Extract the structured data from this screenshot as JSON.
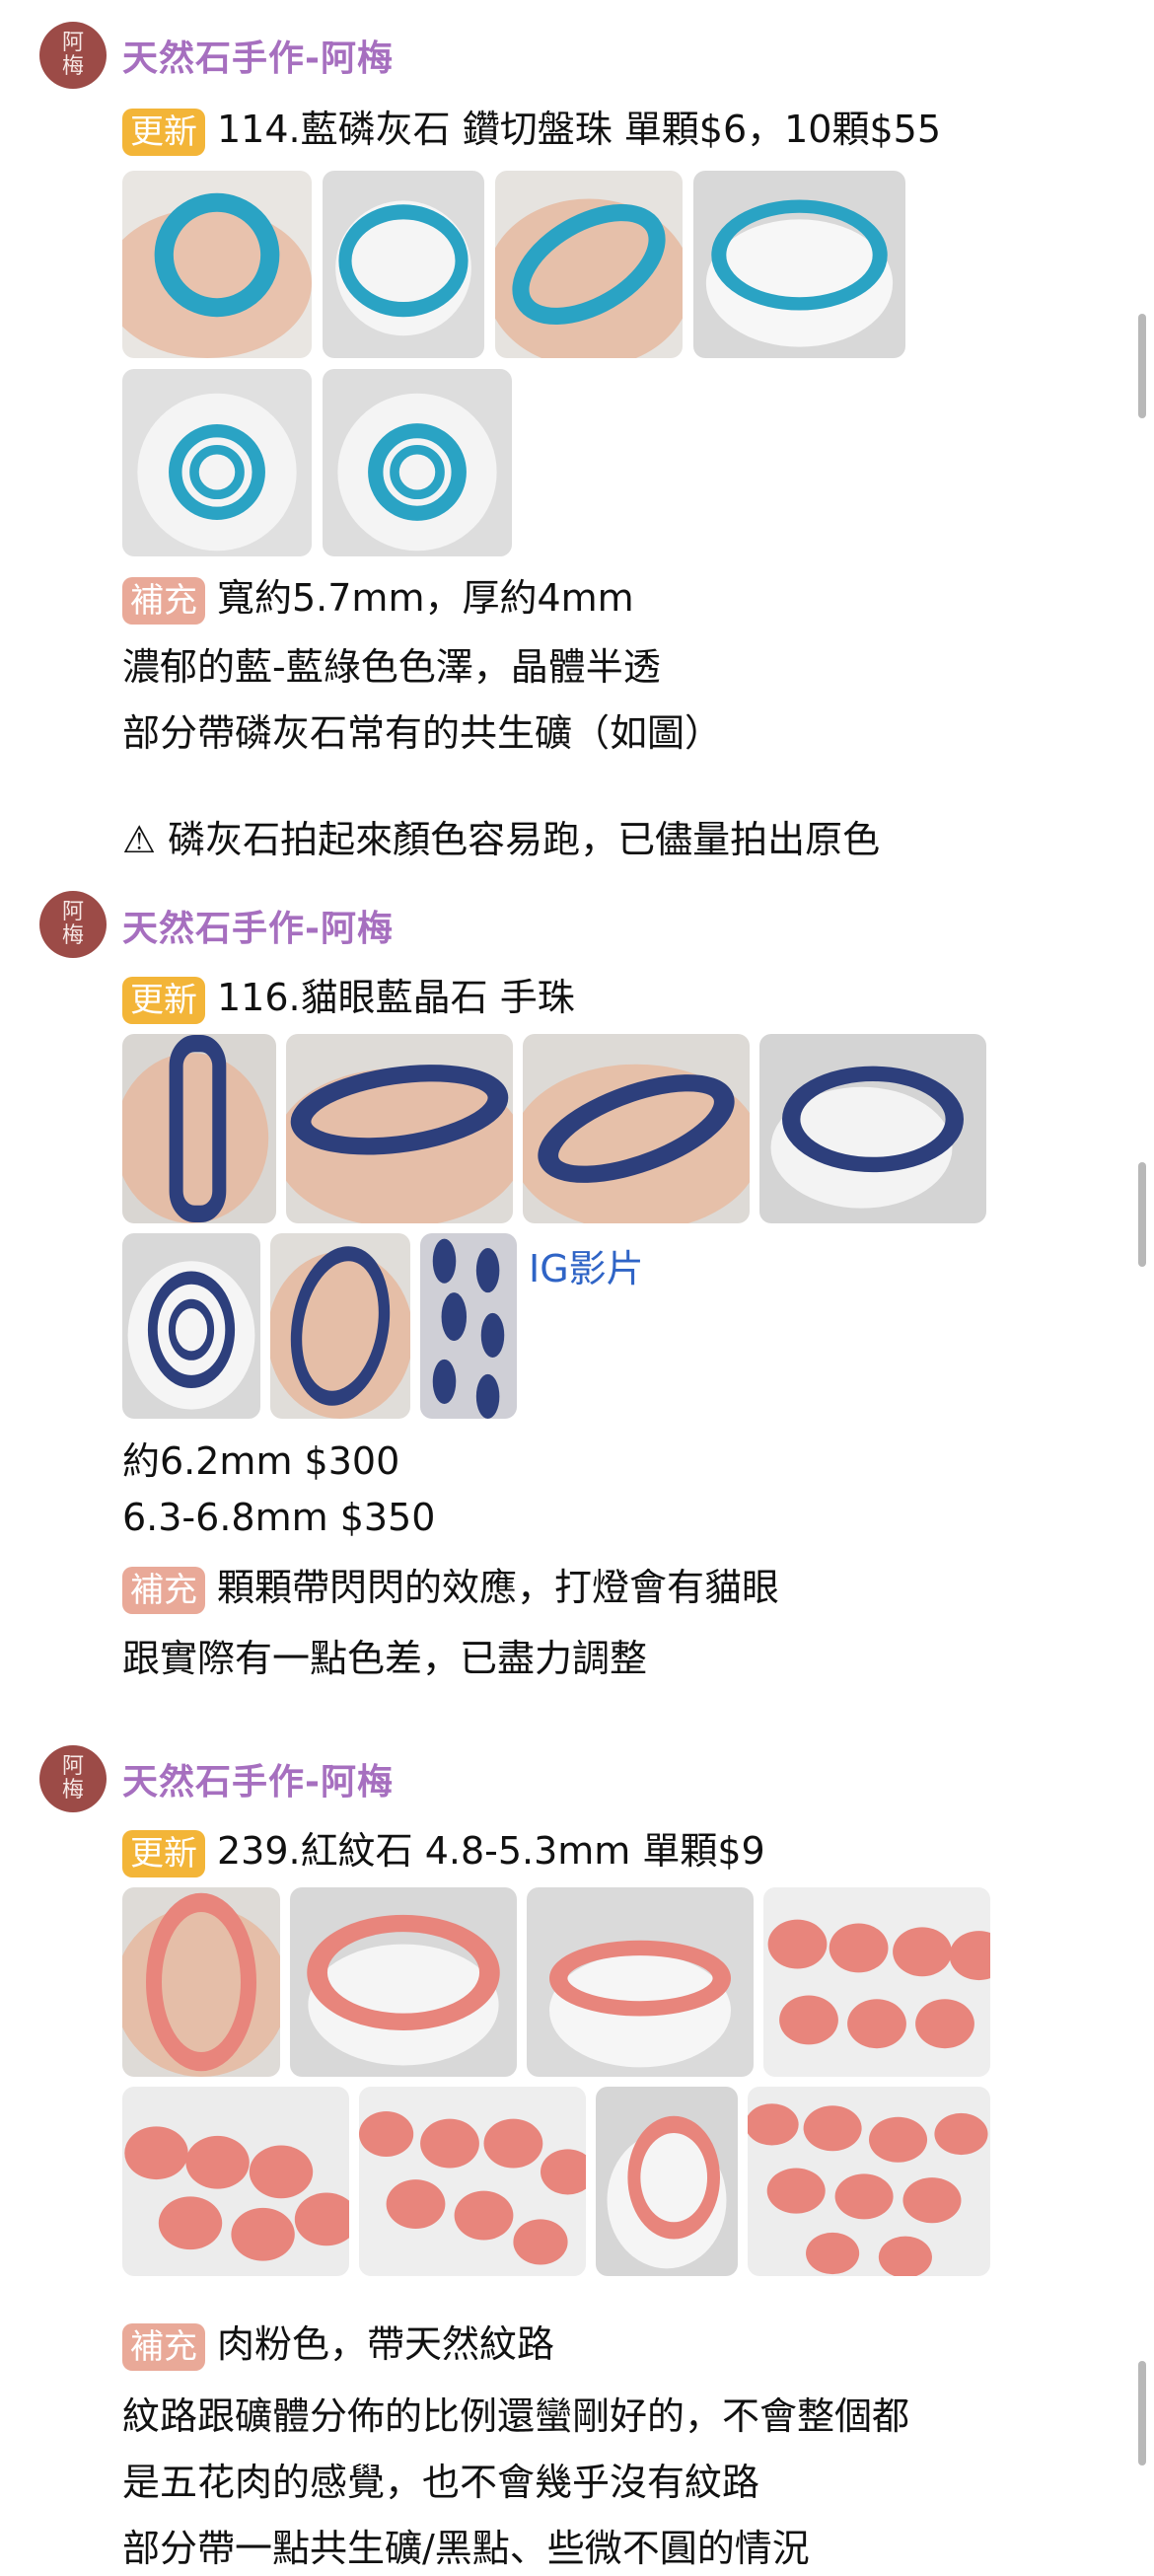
{
  "posts": [
    {
      "avatar_text": [
        "阿",
        "梅"
      ],
      "author": "天然石手作-阿梅",
      "update_tag": "更新",
      "title": "114.藍磷灰石 鑽切盤珠 單顆$6，10顆$55",
      "supplement_tag": "補充",
      "supplement": "寬約5.7mm，厚約4mm",
      "lines": [
        "濃郁的藍-藍綠色色澤，晶體半透",
        "部分帶磷灰石常有的共生礦（如圖）",
        "⚠ 磷灰石拍起來顏色容易跑，已儘量拍出原色"
      ],
      "photo_color": "#2aa3c4"
    },
    {
      "avatar_text": [
        "阿",
        "梅"
      ],
      "author": "天然石手作-阿梅",
      "update_tag": "更新",
      "title": "116.貓眼藍晶石 手珠",
      "link": "IG影片",
      "prices": [
        "約6.2mm $300",
        "6.3-6.8mm $350"
      ],
      "supplement_tag": "補充",
      "supplement": "顆顆帶閃閃的效應，打燈會有貓眼",
      "lines": [
        "跟實際有一點色差，已盡力調整"
      ],
      "photo_color": "#2d3f7c"
    },
    {
      "avatar_text": [
        "阿",
        "梅"
      ],
      "author": "天然石手作-阿梅",
      "update_tag": "更新",
      "title": "239.紅紋石 4.8-5.3mm 單顆$9",
      "supplement_tag": "補充",
      "supplement": "肉粉色，帶天然紋路",
      "lines": [
        "紋路跟礦體分佈的比例還蠻剛好的，不會整個都",
        "是五花肉的感覺，也不會幾乎沒有紋路",
        "部分帶一點共生礦/黑點、些微不圓的情況"
      ],
      "photo_color": "#e8857c"
    }
  ]
}
